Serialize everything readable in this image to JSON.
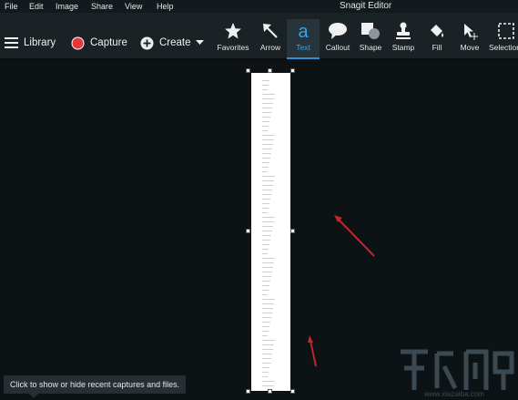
{
  "menu": {
    "items": [
      "File",
      "Edit",
      "Image",
      "Share",
      "View",
      "Help"
    ],
    "app_title": "Snagit Editor"
  },
  "toolbar": {
    "library_label": "Library",
    "capture_label": "Capture",
    "create_label": "Create",
    "tools": [
      {
        "label": "Favorites",
        "icon": "star-icon"
      },
      {
        "label": "Arrow",
        "icon": "arrow-icon"
      },
      {
        "label": "Text",
        "icon": "text-icon",
        "active": true
      },
      {
        "label": "Callout",
        "icon": "callout-icon"
      },
      {
        "label": "Shape",
        "icon": "shape-icon"
      },
      {
        "label": "Stamp",
        "icon": "stamp-icon"
      },
      {
        "label": "Fill",
        "icon": "fill-icon"
      },
      {
        "label": "Move",
        "icon": "move-icon"
      },
      {
        "label": "Selection",
        "icon": "selection-icon"
      }
    ],
    "active_color": "#2f8fd8",
    "capture_color": "#e03a3a"
  },
  "canvas": {
    "annotation_color": "#c0272d"
  },
  "tooltip": {
    "text": "Click to show or hide recent captures and files."
  },
  "watermark": {
    "url": "www.xiazaiba.com"
  }
}
